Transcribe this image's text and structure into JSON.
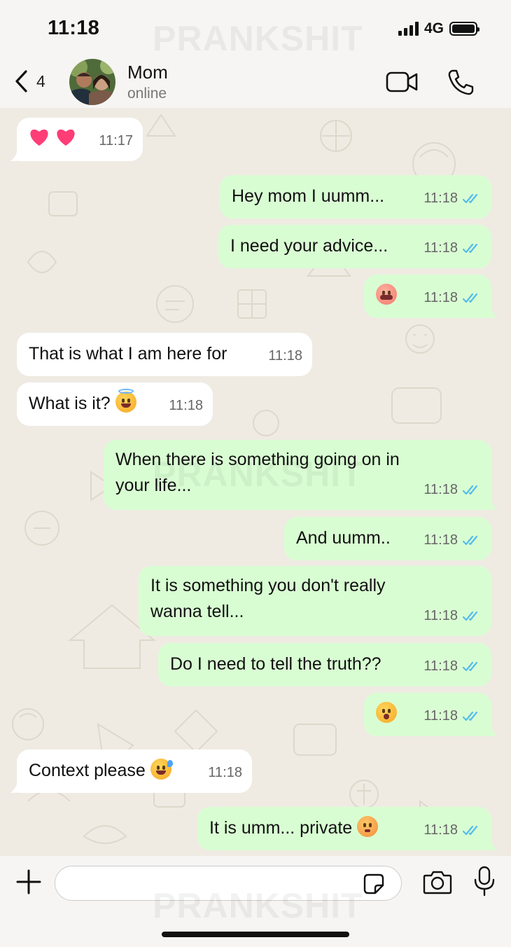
{
  "status_bar": {
    "time": "11:18",
    "network": "4G",
    "icons": [
      "signal-icon",
      "battery-icon"
    ]
  },
  "watermark": "PRANKSHIT",
  "header": {
    "back_count": "4",
    "contact_name": "Mom",
    "contact_status": "online",
    "icons": [
      "chevron-left-icon",
      "video-call-icon",
      "phone-icon"
    ]
  },
  "messages": [
    {
      "dir": "in",
      "text": "",
      "time": "11:17",
      "emoji": "two-hearts"
    },
    {
      "dir": "out",
      "text": "Hey mom I uumm...",
      "time": "11:18"
    },
    {
      "dir": "out",
      "text": "I need your advice...",
      "time": "11:18"
    },
    {
      "dir": "out",
      "text": "",
      "time": "11:18",
      "emoji": "grimacing-face"
    },
    {
      "dir": "in",
      "text": "That is what I am here for",
      "time": "11:18"
    },
    {
      "dir": "in",
      "text": "What is it?",
      "time": "11:18",
      "emoji": "smiling-face-with-halo"
    },
    {
      "dir": "out",
      "text": "When there is something going on in your life...",
      "time": "11:18"
    },
    {
      "dir": "out",
      "text": "And uumm..",
      "time": "11:18"
    },
    {
      "dir": "out",
      "text": "It is something you don't really wanna tell...",
      "time": "11:18"
    },
    {
      "dir": "out",
      "text": "Do I need to tell the truth??",
      "time": "11:18"
    },
    {
      "dir": "out",
      "text": "",
      "time": "11:18",
      "emoji": "face-holding-back-tears"
    },
    {
      "dir": "in",
      "text": "Context please",
      "time": "11:18",
      "emoji": "grinning-face-with-sweat"
    },
    {
      "dir": "out",
      "text": "It is umm... private",
      "time": "11:18",
      "emoji": "flushed-face"
    }
  ],
  "composer": {
    "placeholder": "",
    "icons": [
      "plus-icon",
      "sticker-icon",
      "camera-icon",
      "microphone-icon"
    ]
  },
  "colors": {
    "incoming": "#ffffff",
    "outgoing": "#d9fdd3",
    "read_ticks": "#53bdeb",
    "chat_bg": "#efebe3"
  }
}
